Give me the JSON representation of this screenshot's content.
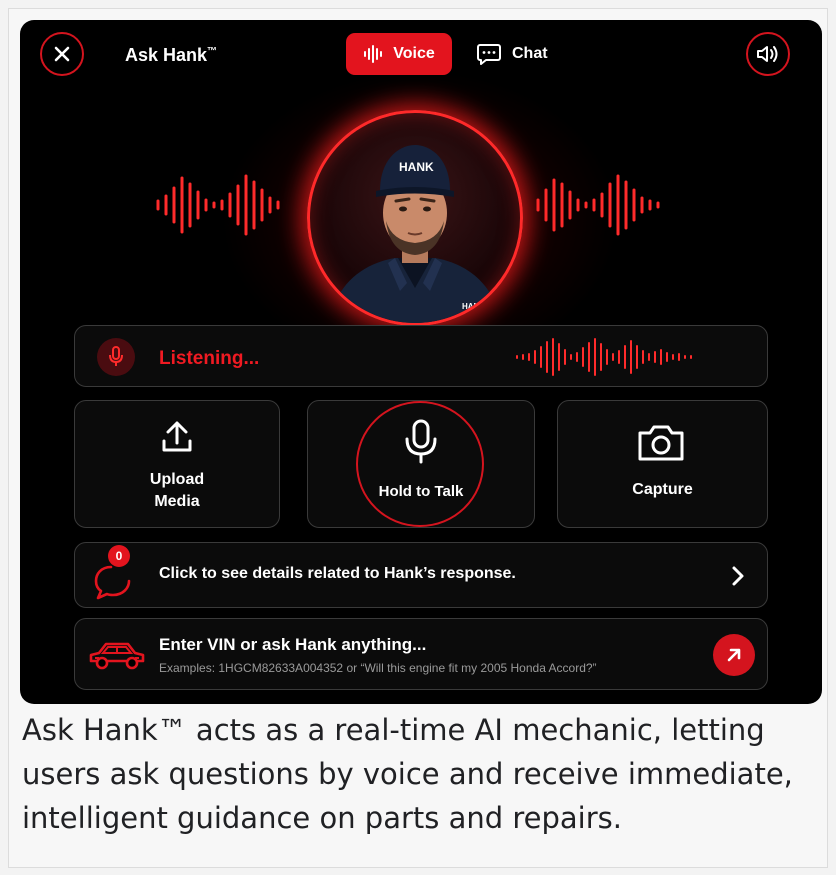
{
  "header": {
    "title": "Ask Hank",
    "title_mark": "™",
    "voice_tab_label": "Voice",
    "chat_tab_label": "Chat"
  },
  "avatar": {
    "cap_text": "HANK",
    "shirt_text": "HANK"
  },
  "status": {
    "text": "Listening..."
  },
  "actions": {
    "upload_line1": "Upload",
    "upload_line2": "Media",
    "talk_label": "Hold to Talk",
    "capture_label": "Capture"
  },
  "details": {
    "badge_count": "0",
    "text": "Click to see details related to Hank’s response."
  },
  "input": {
    "main_text": "Enter VIN or ask Hank anything...",
    "examples_text": "Examples: 1HGCM82633A004352 or “Will this engine fit my 2005 Honda Accord?”"
  },
  "caption": {
    "text": "Ask Hank™ acts as a real-time AI mechanic, letting users ask questions by voice and receive immediate, intelligent guidance on parts and repairs."
  },
  "colors": {
    "accent": "#e3141e",
    "background": "#000000",
    "panel_border": "#3a3a3a"
  },
  "icons": [
    "close-icon",
    "speaker-icon",
    "waveform-icon",
    "chat-bubble-icon",
    "microphone-icon",
    "upload-icon",
    "camera-icon",
    "notification-bubble-icon",
    "chevron-right-icon",
    "car-icon",
    "arrow-up-right-icon"
  ]
}
